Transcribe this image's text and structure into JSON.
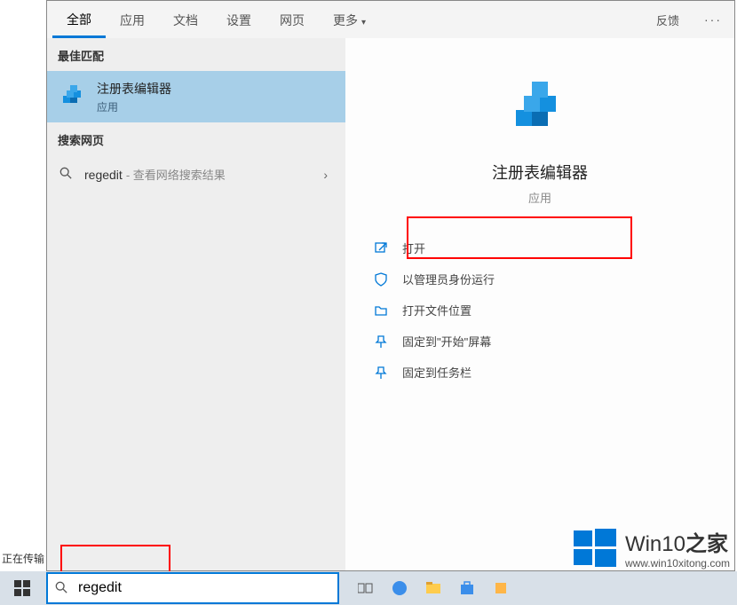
{
  "tabs": {
    "items": [
      "全部",
      "应用",
      "文档",
      "设置",
      "网页",
      "更多"
    ],
    "feedback": "反馈"
  },
  "sections": {
    "best_match_header": "最佳匹配",
    "web_header": "搜索网页"
  },
  "best_match": {
    "title": "注册表编辑器",
    "subtitle": "应用"
  },
  "web_result": {
    "term": "regedit",
    "suffix": "- 查看网络搜索结果"
  },
  "right": {
    "title": "注册表编辑器",
    "subtitle": "应用"
  },
  "actions": {
    "open": "打开",
    "run_admin": "以管理员身份运行",
    "open_location": "打开文件位置",
    "pin_start": "固定到\"开始\"屏幕",
    "pin_taskbar": "固定到任务栏"
  },
  "search": {
    "value": "regedit"
  },
  "watermark": {
    "title_main": "Win10",
    "title_suffix": "之家",
    "url": "www.win10xitong.com"
  },
  "status": "正在传输"
}
